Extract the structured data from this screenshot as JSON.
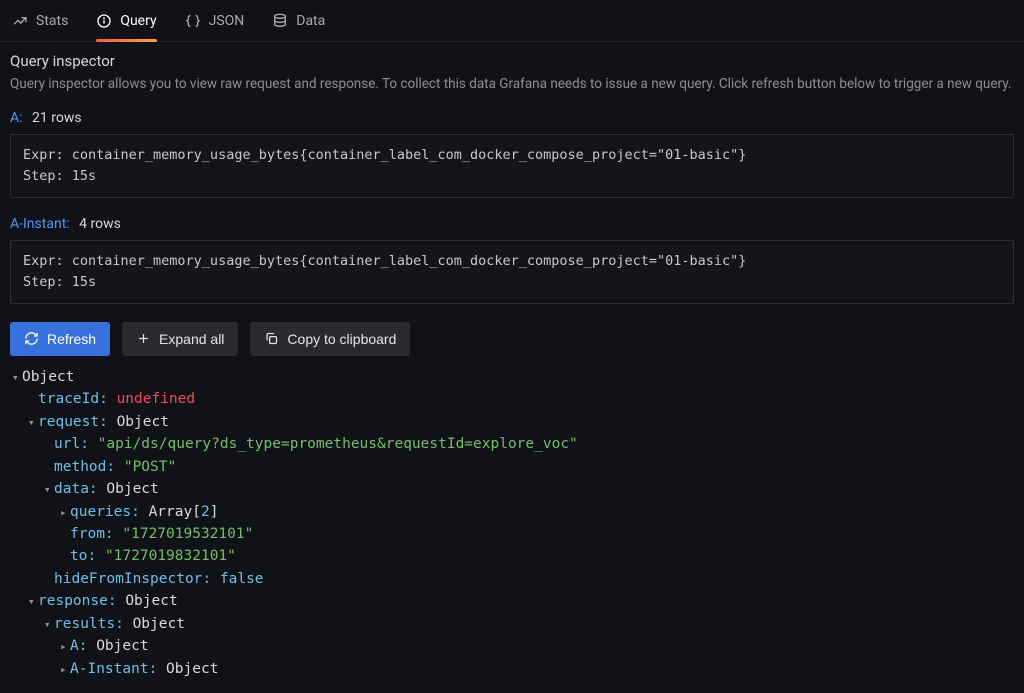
{
  "tabs": {
    "stats": "Stats",
    "query": "Query",
    "json": "JSON",
    "data": "Data"
  },
  "inspector": {
    "title": "Query inspector",
    "desc": "Query inspector allows you to view raw request and response. To collect this data Grafana needs to issue a new query. Click refresh button below to trigger a new query."
  },
  "queries": [
    {
      "name": "A:",
      "rows": "21 rows",
      "expr": "Expr: container_memory_usage_bytes{container_label_com_docker_compose_project=\"01-basic\"}",
      "step": "Step: 15s"
    },
    {
      "name": "A-Instant:",
      "rows": "4 rows",
      "expr": "Expr: container_memory_usage_bytes{container_label_com_docker_compose_project=\"01-basic\"}",
      "step": "Step: 15s"
    }
  ],
  "buttons": {
    "refresh": "Refresh",
    "expand": "Expand all",
    "copy": "Copy to clipboard"
  },
  "tree": {
    "root": "Object",
    "traceId_key": "traceId:",
    "traceId_val": "undefined",
    "request_key": "request:",
    "request_val": "Object",
    "url_key": "url:",
    "url_val": "\"api/ds/query?ds_type=prometheus&requestId=explore_voc\"",
    "method_key": "method:",
    "method_val": "\"POST\"",
    "data_key": "data:",
    "data_val": "Object",
    "queries_key": "queries:",
    "queries_val_a": "Array",
    "queries_val_b": "[",
    "queries_val_c": "2",
    "queries_val_d": "]",
    "from_key": "from:",
    "from_val": "\"1727019532101\"",
    "to_key": "to:",
    "to_val": "\"1727019832101\"",
    "hide_key": "hideFromInspector:",
    "hide_val": "false",
    "response_key": "response:",
    "response_val": "Object",
    "results_key": "results:",
    "results_val": "Object",
    "resA_key": "A:",
    "resA_val": "Object",
    "resAI_key": "A-Instant:",
    "resAI_val": "Object"
  }
}
